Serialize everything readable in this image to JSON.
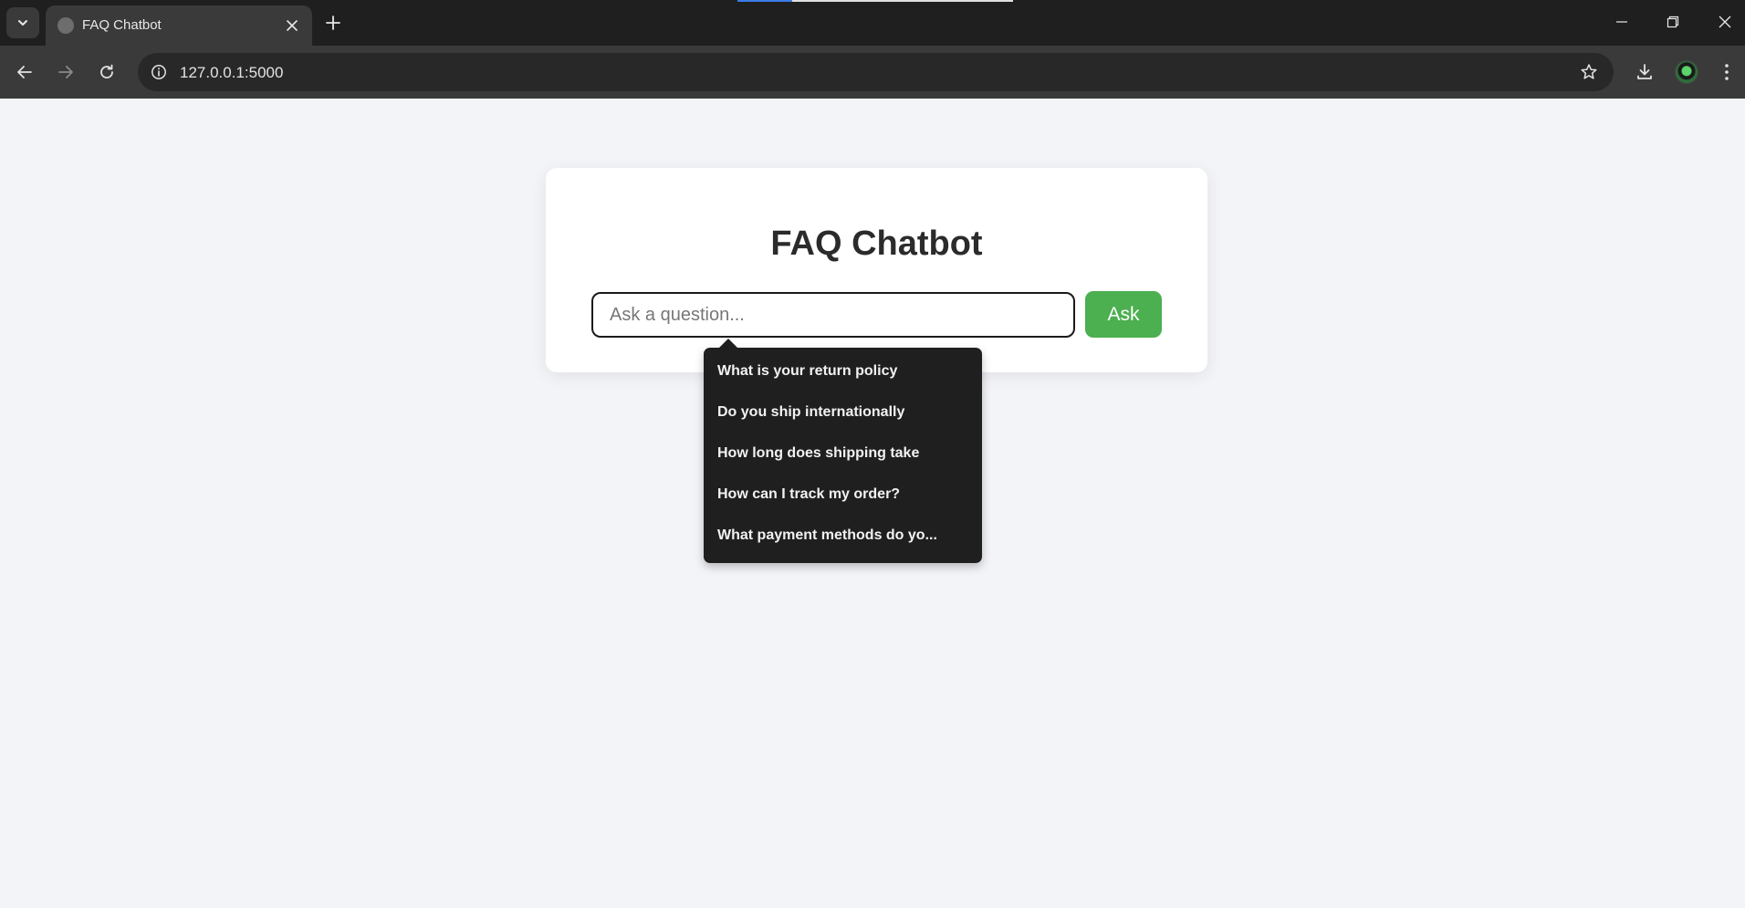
{
  "browser": {
    "tab_title": "FAQ Chatbot",
    "url": "127.0.0.1:5000",
    "loading_progress": 0.2
  },
  "page": {
    "title": "FAQ Chatbot",
    "input_placeholder": "Ask a question...",
    "input_value": "",
    "ask_label": "Ask",
    "accent_color": "#4caf50"
  },
  "suggestions": [
    "What is your return policy",
    "Do you ship internationally",
    "How long does shipping take",
    "How can I track my order?",
    "What payment methods do yo..."
  ]
}
